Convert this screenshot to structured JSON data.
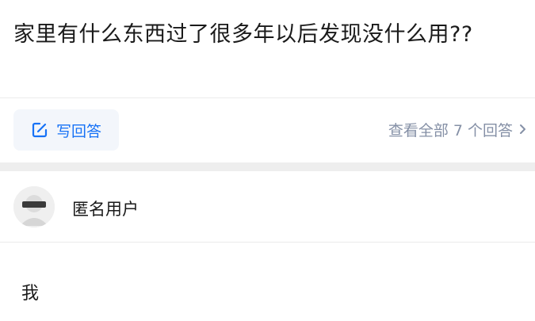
{
  "question": {
    "title": "家里有什么东西过了很多年以后发现没什么用??"
  },
  "actions": {
    "write_answer_label": "写回答",
    "view_all_label": "查看全部 7 个回答",
    "answer_count": 7
  },
  "answer": {
    "author_name": "匿名用户",
    "text": "我"
  },
  "colors": {
    "accent": "#1772f6",
    "muted": "#8590a6",
    "write_button_bg": "#f3f6fb",
    "separator_band": "#eeeeee"
  },
  "icons": {
    "write": "edit-pencil-icon",
    "view_all": "chevron-right-icon",
    "avatar": "anonymous-avatar-icon"
  }
}
